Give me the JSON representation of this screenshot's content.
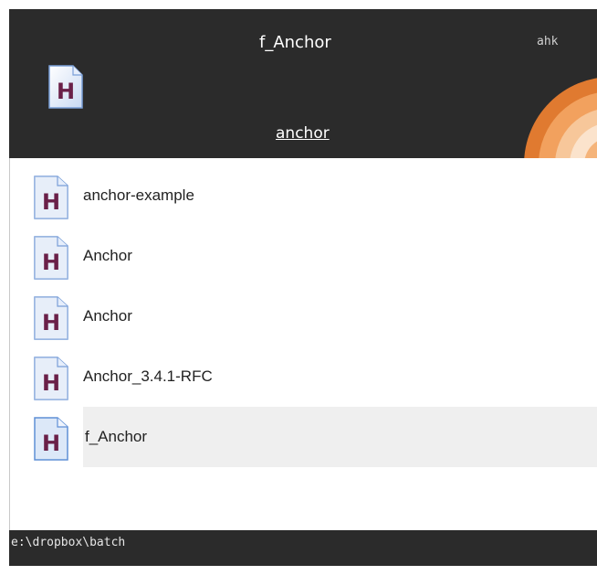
{
  "header": {
    "title": "f_Anchor",
    "tag": "ahk",
    "query": "anchor"
  },
  "list": {
    "items": [
      {
        "label": "anchor-example",
        "icon": "ahk-file-icon",
        "selected": false
      },
      {
        "label": "Anchor",
        "icon": "ahk-file-icon",
        "selected": false
      },
      {
        "label": "Anchor",
        "icon": "ahk-file-icon",
        "selected": false
      },
      {
        "label": "Anchor_3.4.1-RFC",
        "icon": "ahk-file-icon",
        "selected": false
      },
      {
        "label": "f_Anchor",
        "icon": "ahk-file-icon",
        "selected": true
      }
    ]
  },
  "footer": {
    "path": "e:\\dropbox\\batch"
  },
  "colors": {
    "frame_bg": "#2b2b2b",
    "list_bg": "#ffffff",
    "selected_bg": "#efefef",
    "icon_letter": "#6a2048",
    "accent_orange": "#e8863a"
  }
}
